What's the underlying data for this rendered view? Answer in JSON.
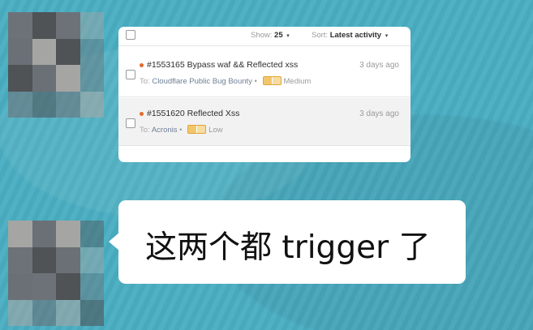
{
  "list": {
    "show_label": "Show:",
    "show_value": "25",
    "sort_label": "Sort:",
    "sort_value": "Latest activity",
    "reports": [
      {
        "title": "#1553165 Bypass waf && Reflected xss",
        "date": "3 days ago",
        "to_label": "To:",
        "program": "Cloudflare Public Bug Bounty",
        "separator": "•",
        "severity": "Medium",
        "status_color": "#e26b2a"
      },
      {
        "title": "#1551620 Reflected Xss",
        "date": "3 days ago",
        "to_label": "To:",
        "program": "Acronis",
        "separator": "•",
        "severity": "Low",
        "status_color": "#e26b2a"
      }
    ]
  },
  "message": {
    "text": "这两个都 trigger 了"
  },
  "colors": {
    "chat_background": "#4aaec2",
    "severity_icon": "#f1c76b",
    "status_dot": "#e26b2a"
  },
  "icons": {
    "checkbox": "checkbox-icon",
    "caret": "caret-down-icon",
    "severity": "severity-bar-icon",
    "status": "status-dot-icon"
  }
}
